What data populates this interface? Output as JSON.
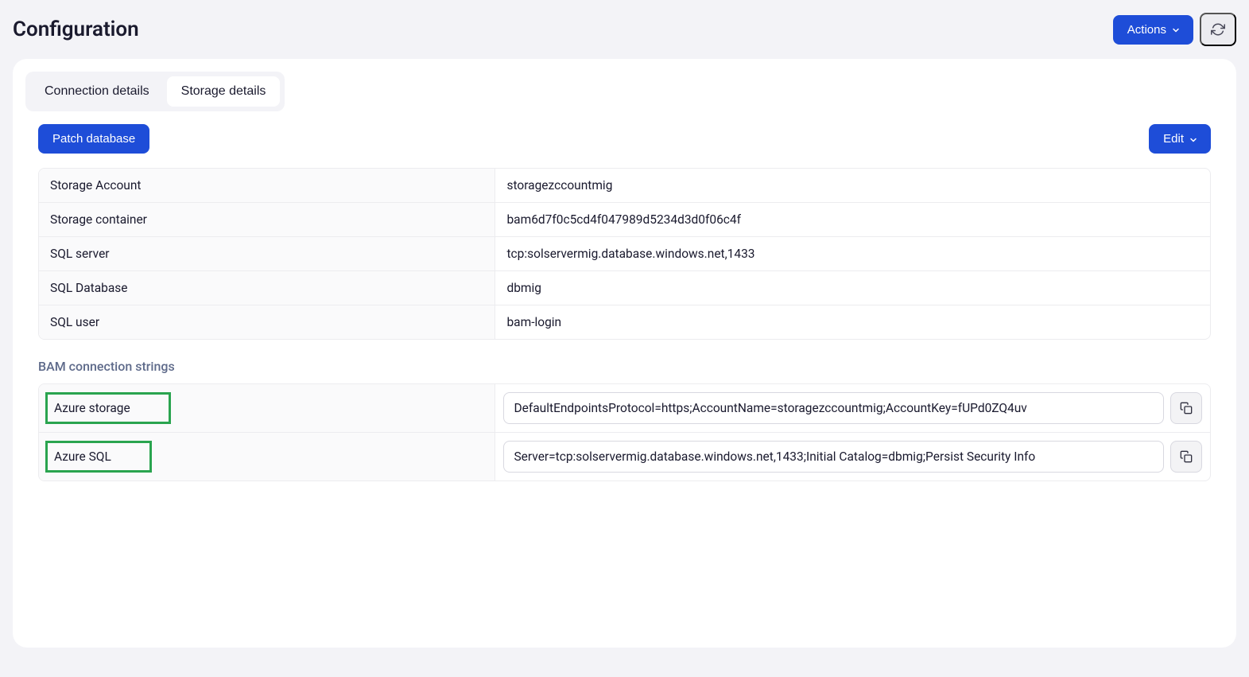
{
  "header": {
    "title": "Configuration",
    "actions_label": "Actions"
  },
  "tabs": [
    {
      "label": "Connection details",
      "active": false
    },
    {
      "label": "Storage details",
      "active": true
    }
  ],
  "buttons": {
    "patch": "Patch database",
    "edit": "Edit"
  },
  "storage": {
    "rows": [
      {
        "label": "Storage Account",
        "value": "storagezccountmig"
      },
      {
        "label": "Storage container",
        "value": "bam6d7f0c5cd4f047989d5234d3d0f06c4f"
      },
      {
        "label": "SQL server",
        "value": "tcp:solservermig.database.windows.net,1433"
      },
      {
        "label": "SQL Database",
        "value": "dbmig"
      },
      {
        "label": "SQL user",
        "value": "bam-login"
      }
    ]
  },
  "connection_strings": {
    "heading": "BAM connection strings",
    "rows": [
      {
        "label": "Azure storage",
        "value": "DefaultEndpointsProtocol=https;AccountName=storagezccountmig;AccountKey=fUPd0ZQ4uv"
      },
      {
        "label": "Azure SQL",
        "value": "Server=tcp:solservermig.database.windows.net,1433;Initial Catalog=dbmig;Persist Security Info"
      }
    ]
  }
}
